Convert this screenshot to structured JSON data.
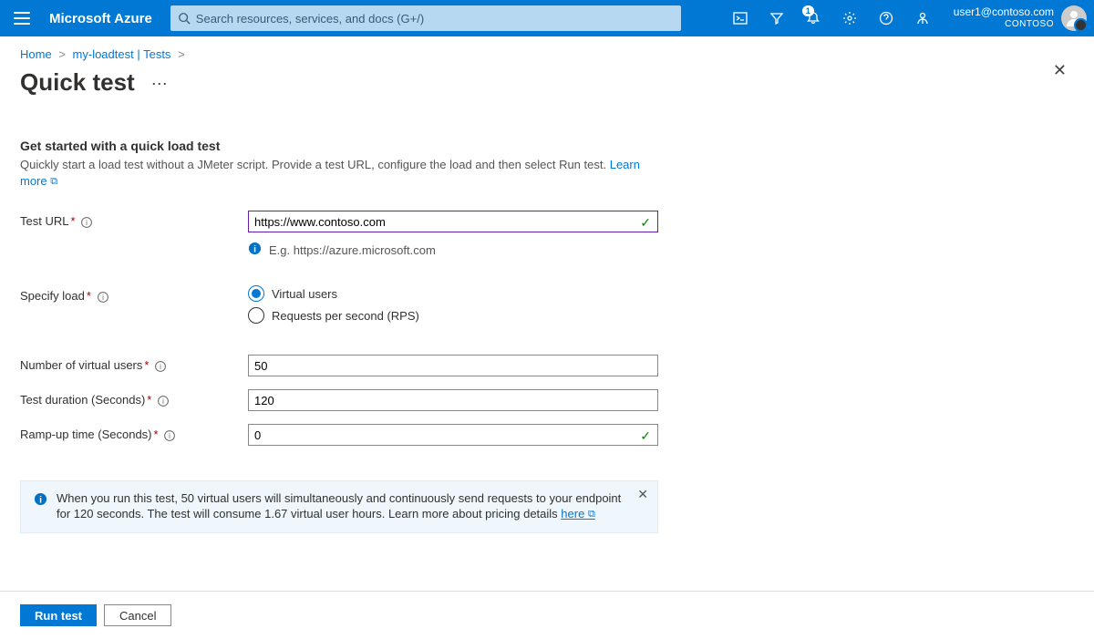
{
  "topbar": {
    "brand": "Microsoft Azure",
    "search_placeholder": "Search resources, services, and docs (G+/)",
    "notification_count": "1",
    "user_email": "user1@contoso.com",
    "tenant": "CONTOSO"
  },
  "breadcrumbs": {
    "home": "Home",
    "item1": "my-loadtest | Tests"
  },
  "page": {
    "title": "Quick test"
  },
  "section": {
    "heading": "Get started with a quick load test",
    "desc": "Quickly start a load test without a JMeter script. Provide a test URL, configure the load and then select Run test. ",
    "learn_more": "Learn more"
  },
  "form": {
    "test_url_label": "Test URL",
    "test_url_value": "https://www.contoso.com",
    "test_url_hint": "E.g. https://azure.microsoft.com",
    "specify_load_label": "Specify load",
    "radio_vu": "Virtual users",
    "radio_rps": "Requests per second (RPS)",
    "num_users_label": "Number of virtual users",
    "num_users_value": "50",
    "duration_label": "Test duration (Seconds)",
    "duration_value": "120",
    "rampup_label": "Ramp-up time (Seconds)",
    "rampup_value": "0"
  },
  "notice": {
    "text_a": "When you run this test, 50 virtual users will simultaneously and continuously send requests to your endpoint for 120 seconds. The test will consume 1.67 virtual user hours. Learn more about pricing details ",
    "here": "here"
  },
  "footer": {
    "run": "Run test",
    "cancel": "Cancel"
  }
}
